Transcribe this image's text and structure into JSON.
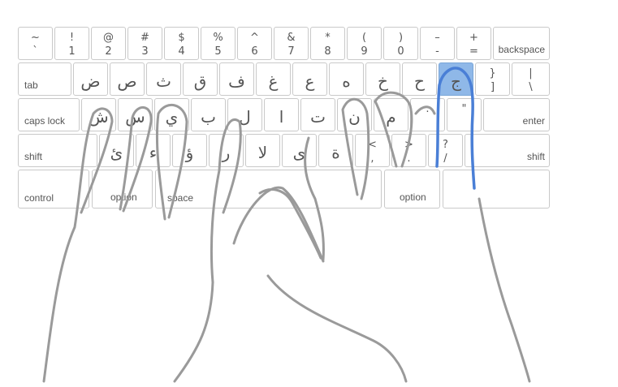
{
  "keyboard": {
    "row1": [
      {
        "top": "~",
        "bottom": "`"
      },
      {
        "top": "!",
        "bottom": "1"
      },
      {
        "top": "@",
        "bottom": "2"
      },
      {
        "top": "#",
        "bottom": "3"
      },
      {
        "top": "$",
        "bottom": "4"
      },
      {
        "top": "%",
        "bottom": "5"
      },
      {
        "top": "^",
        "bottom": "6"
      },
      {
        "top": "&",
        "bottom": "7"
      },
      {
        "top": "*",
        "bottom": "8"
      },
      {
        "top": "(",
        "bottom": "9"
      },
      {
        "top": ")",
        "bottom": "0"
      },
      {
        "top": "–",
        "bottom": "-"
      },
      {
        "top": "+",
        "bottom": "="
      }
    ],
    "backspace": "backspace",
    "tab": "tab",
    "row2": [
      "ض",
      "ص",
      "ث",
      "ق",
      "ف",
      "غ",
      "ع",
      "ه",
      "خ",
      "ح",
      "ج"
    ],
    "bracket_close": {
      "top": "}",
      "bottom": "]"
    },
    "pipe": {
      "top": "|",
      "bottom": "\\"
    },
    "caps_lock": "caps lock",
    "row3": [
      "ش",
      "س",
      "ي",
      "ب",
      "ل",
      "ا",
      "ت",
      "ن",
      "م"
    ],
    "colon": {
      "top": ":",
      "bottom": ""
    },
    "quote": {
      "top": "\"",
      "bottom": ""
    },
    "enter": "enter",
    "shift_left": "shift",
    "row4": [
      "ئ",
      "ء",
      "ؤ",
      "ر",
      "لا",
      "ى",
      "ة"
    ],
    "less": {
      "top": "<",
      "bottom": ","
    },
    "greater": {
      "top": ">",
      "bottom": "."
    },
    "question": {
      "top": "?",
      "bottom": "/"
    },
    "shift_right": "shift",
    "control": "control",
    "option_left": "option",
    "space": "space",
    "option_right": "option",
    "active_key": "ج",
    "active_color": "#8fb8e8",
    "hand_color": "#9a9a9a",
    "active_finger_color": "#4a7fd6"
  }
}
